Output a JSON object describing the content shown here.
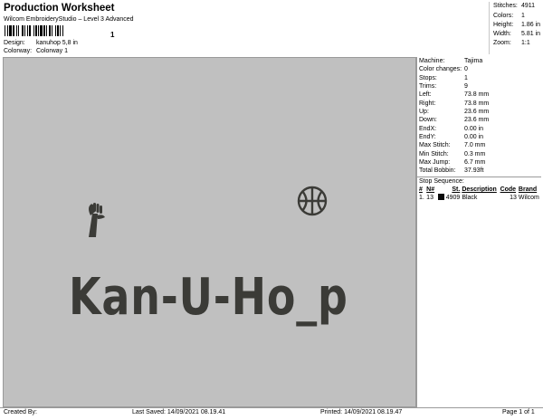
{
  "header": {
    "title": "Production Worksheet",
    "subtitle": "Wilcom EmbroideryStudio – Level 3 Advanced",
    "barcode_digit": "1"
  },
  "meta": [
    {
      "label": "Design:",
      "value": "kanuhop 5,8 in"
    },
    {
      "label": "Colorway:",
      "value": "Colorway 1"
    }
  ],
  "stats": [
    {
      "label": "Stitches:",
      "value": "4911"
    },
    {
      "label": "Colors:",
      "value": "1"
    },
    {
      "label": "Height:",
      "value": "1.86 in"
    },
    {
      "label": "Width:",
      "value": "5.81 in"
    },
    {
      "label": "Zoom:",
      "value": "1:1"
    }
  ],
  "design": {
    "text": "Kan-U-Ho_p",
    "thread_color": "#3b3b37"
  },
  "machine_info": [
    {
      "label": "Machine:",
      "value": "Tajima"
    },
    {
      "label": "Color changes:",
      "value": "0"
    },
    {
      "label": "Stops:",
      "value": "1"
    },
    {
      "label": "Trims:",
      "value": "9"
    },
    {
      "label": "Left:",
      "value": "73.8 mm"
    },
    {
      "label": "Right:",
      "value": "73.8 mm"
    },
    {
      "label": "Up:",
      "value": "23.6 mm"
    },
    {
      "label": "Down:",
      "value": "23.6 mm"
    },
    {
      "label": "EndX:",
      "value": "0.00 in"
    },
    {
      "label": "EndY:",
      "value": "0.00 in"
    },
    {
      "label": "Max Stitch:",
      "value": "7.0 mm"
    },
    {
      "label": "Min Stitch:",
      "value": "0.3 mm"
    },
    {
      "label": "Max Jump:",
      "value": "6.7 mm"
    },
    {
      "label": "Total Bobbin:",
      "value": "37.93ft"
    }
  ],
  "stop_sequence": {
    "title": "Stop Sequence:",
    "columns": [
      "#",
      "N#",
      "St.",
      "Description",
      "Code",
      "Brand"
    ],
    "rows": [
      {
        "num": "1.",
        "n": "13",
        "swatch": "#0a0a0a",
        "st": "4909",
        "description": "Black",
        "code": "13",
        "brand": "Wilcom"
      }
    ]
  },
  "footer": {
    "created_by": "Created By:",
    "last_saved": "Last Saved:  14/09/2021 08.19.41",
    "printed": "Printed:  14/09/2021 08.19.47",
    "page": "Page 1 of 1"
  }
}
